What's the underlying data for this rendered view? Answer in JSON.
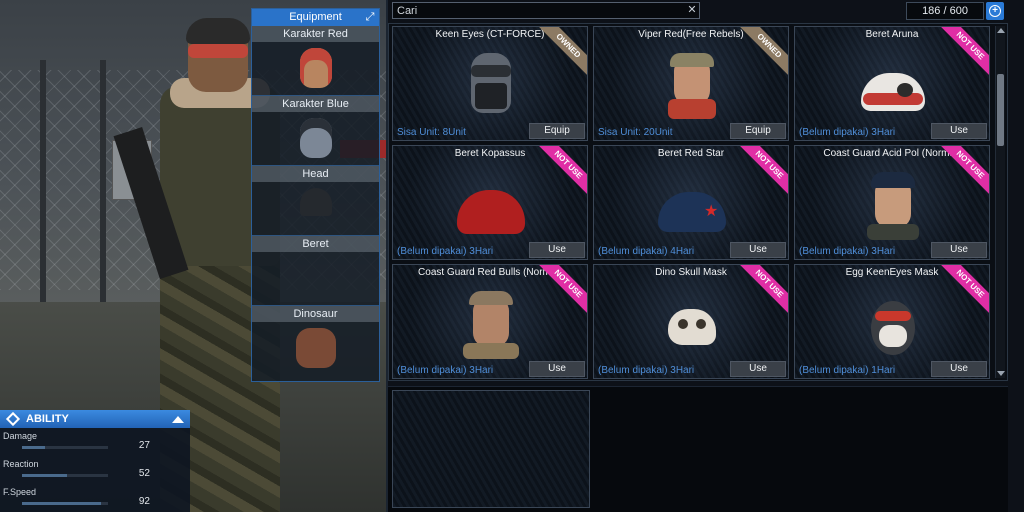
{
  "equipment": {
    "title": "Equipment",
    "slots": [
      {
        "label": "Karakter Red"
      },
      {
        "label": "Karakter Blue"
      },
      {
        "label": "Head"
      },
      {
        "label": "Beret"
      },
      {
        "label": "Dinosaur"
      }
    ]
  },
  "ability": {
    "title": "ABILITY",
    "stats": [
      {
        "label": "Damage",
        "value": "27",
        "level": 0.27
      },
      {
        "label": "Reaction",
        "value": "52",
        "level": 0.52
      },
      {
        "label": "F.Speed",
        "value": "92",
        "level": 0.92
      }
    ]
  },
  "search": {
    "value": "Cari"
  },
  "inventory_count": "186 / 600",
  "items": [
    {
      "title": "Keen Eyes (CT-FORCE)",
      "info": "Sisa Unit: 8Unit",
      "button": "Equip",
      "tag": "OWNED"
    },
    {
      "title": "Viper Red(Free Rebels)",
      "info": "Sisa Unit: 20Unit",
      "button": "Equip",
      "tag": "OWNED"
    },
    {
      "title": "Beret Aruna",
      "info": "(Belum dipakai) 3Hari",
      "button": "Use",
      "tag": "NOT USE"
    },
    {
      "title": "Beret Kopassus",
      "info": "(Belum dipakai) 3Hari",
      "button": "Use",
      "tag": "NOT USE"
    },
    {
      "title": "Beret Red Star",
      "info": "(Belum dipakai) 4Hari",
      "button": "Use",
      "tag": "NOT USE"
    },
    {
      "title": "Coast Guard Acid Pol (Normal)",
      "info": "(Belum dipakai) 3Hari",
      "button": "Use",
      "tag": "NOT USE"
    },
    {
      "title": "Coast Guard Red Bulls (Normal)",
      "info": "(Belum dipakai) 3Hari",
      "button": "Use",
      "tag": "NOT USE"
    },
    {
      "title": "Dino Skull Mask",
      "info": "(Belum dipakai) 3Hari",
      "button": "Use",
      "tag": "NOT USE"
    },
    {
      "title": "Egg KeenEyes Mask",
      "info": "(Belum dipakai) 1Hari",
      "button": "Use",
      "tag": "NOT USE"
    }
  ],
  "colors": {
    "accent": "#2a73c9",
    "owned_tag": "#8c7a63",
    "not_use_tag": "#e02ea5",
    "info_text": "#4f8ed8"
  }
}
